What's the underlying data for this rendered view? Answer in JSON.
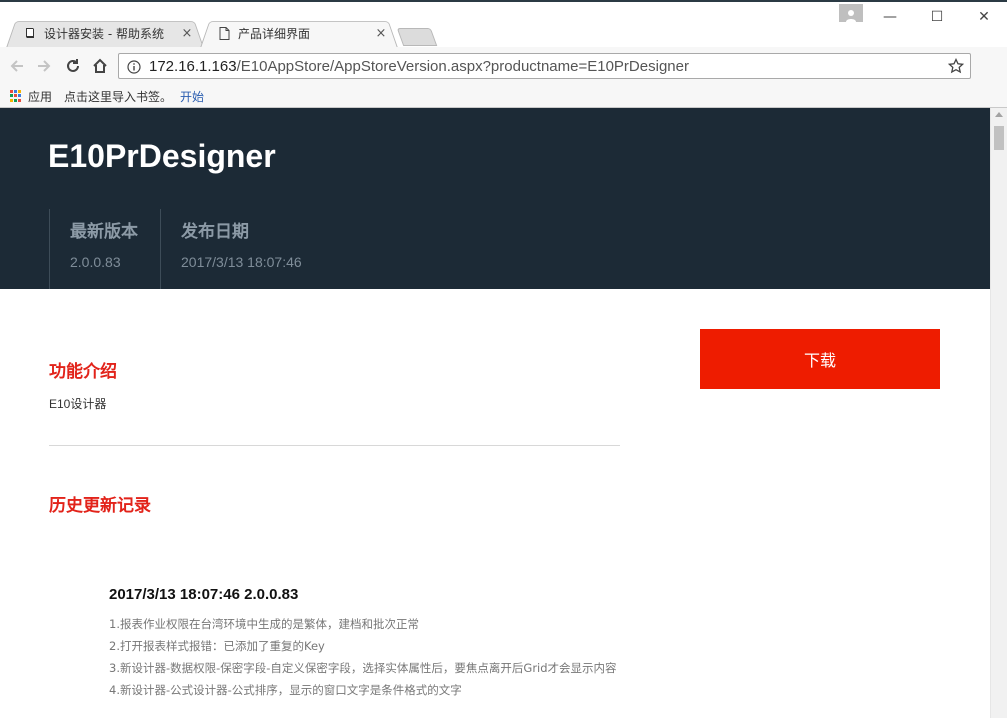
{
  "browser": {
    "tabs": [
      {
        "label": "设计器安装 - 帮助系统",
        "active": false,
        "icon": "book-icon"
      },
      {
        "label": "产品详细界面",
        "active": true,
        "icon": "page-icon"
      }
    ],
    "close_glyph": "×",
    "window": {
      "minimize": "—",
      "maximize": "☐",
      "close": "✕"
    },
    "address": {
      "host": "172.16.1.163",
      "path": "/E10AppStore/AppStoreVersion.aspx?productname=E10PrDesigner"
    },
    "bookmarks": {
      "apps_label": "应用",
      "hint": "点击这里导入书签。",
      "start_link": "开始"
    }
  },
  "page": {
    "product_name": "E10PrDesigner",
    "stats": [
      {
        "label": "最新版本",
        "value": "2.0.0.83"
      },
      {
        "label": "发布日期",
        "value": "2017/3/13 18:07:46"
      }
    ],
    "download_label": "下载",
    "feature": {
      "title": "功能介绍",
      "description": "E10设计器"
    },
    "history": {
      "title": "历史更新记录",
      "releases": [
        {
          "heading": "2017/3/13 18:07:46 2.0.0.83",
          "items": [
            "1.报表作业权限在台湾环境中生成的是繁体，建档和批次正常",
            "2.打开报表样式报错：已添加了重复的Key",
            "3.新设计器-数据权限-保密字段-自定义保密字段，选择实体属性后，要焦点离开后Grid才会显示内容",
            "4.新设计器-公式设计器-公式排序，显示的窗口文字是条件格式的文字"
          ]
        }
      ]
    }
  },
  "colors": {
    "hero_bg": "#1c2a36",
    "accent_red": "#e2231a",
    "download_bg": "#ee1c00"
  }
}
